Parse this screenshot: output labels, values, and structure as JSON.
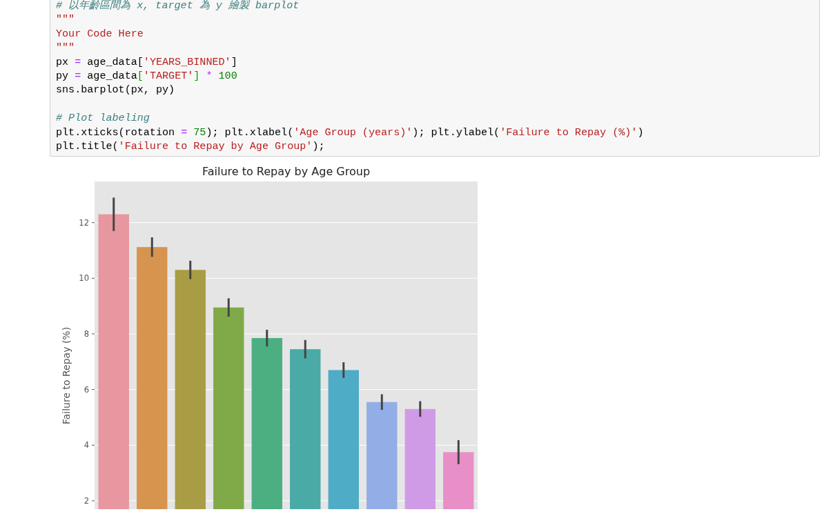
{
  "code_cell": {
    "lines": [
      {
        "kind": "code",
        "tokens": [
          {
            "kind": "comment",
            "text": "# 以年齡區間為 x, target 為 y 繪製 barplot"
          }
        ]
      },
      {
        "kind": "code",
        "tokens": [
          {
            "kind": "string",
            "text": "\"\"\""
          }
        ]
      },
      {
        "kind": "code",
        "tokens": [
          {
            "kind": "string",
            "text": "Your Code Here"
          }
        ]
      },
      {
        "kind": "code",
        "tokens": [
          {
            "kind": "string",
            "text": "\"\"\""
          }
        ]
      },
      {
        "kind": "code",
        "tokens": [
          {
            "kind": "plain",
            "text": "px "
          },
          {
            "kind": "operator",
            "text": "="
          },
          {
            "kind": "plain",
            "text": " age_data["
          },
          {
            "kind": "string",
            "text": "'YEARS_BINNED'"
          },
          {
            "kind": "plain",
            "text": "]"
          }
        ]
      },
      {
        "kind": "code",
        "tokens": [
          {
            "kind": "plain",
            "text": "py "
          },
          {
            "kind": "operator",
            "text": "="
          },
          {
            "kind": "plain",
            "text": " age_data"
          },
          {
            "kind": "bracket",
            "text": "["
          },
          {
            "kind": "string",
            "text": "'TARGET'"
          },
          {
            "kind": "bracket",
            "text": "]"
          },
          {
            "kind": "operator",
            "text": " * "
          },
          {
            "kind": "number",
            "text": "100"
          }
        ]
      },
      {
        "kind": "code",
        "tokens": [
          {
            "kind": "plain",
            "text": "sns.barplot(px, py)"
          }
        ]
      },
      {
        "kind": "blank"
      },
      {
        "kind": "code",
        "tokens": [
          {
            "kind": "comment",
            "text": "# Plot labeling"
          }
        ]
      },
      {
        "kind": "code",
        "tokens": [
          {
            "kind": "plain",
            "text": "plt.xticks(rotation "
          },
          {
            "kind": "operator",
            "text": "= "
          },
          {
            "kind": "number",
            "text": "75"
          },
          {
            "kind": "plain",
            "text": "); plt.xlabel("
          },
          {
            "kind": "string",
            "text": "'Age Group (years)'"
          },
          {
            "kind": "plain",
            "text": "); plt.ylabel("
          },
          {
            "kind": "string",
            "text": "'Failure to Repay (%)'"
          },
          {
            "kind": "plain",
            "text": ")"
          }
        ]
      },
      {
        "kind": "code",
        "tokens": [
          {
            "kind": "plain",
            "text": "plt.title("
          },
          {
            "kind": "string",
            "text": "'Failure to Repay by Age Group'"
          },
          {
            "kind": "plain",
            "text": ");"
          }
        ]
      }
    ]
  },
  "output": {
    "chart_data": {
      "type": "bar",
      "title": "Failure to Repay by Age Group",
      "ylabel": "Failure to Repay (%)",
      "values": [
        12.3,
        11.12,
        10.3,
        8.95,
        7.85,
        7.45,
        6.7,
        5.55,
        5.3,
        3.75
      ],
      "errors": [
        0.6,
        0.35,
        0.33,
        0.33,
        0.3,
        0.33,
        0.28,
        0.28,
        0.28,
        0.43
      ],
      "grid": true,
      "ylim": [
        1.7,
        13.48
      ],
      "yticks": [
        2,
        4,
        6,
        8,
        10,
        12
      ]
    }
  }
}
